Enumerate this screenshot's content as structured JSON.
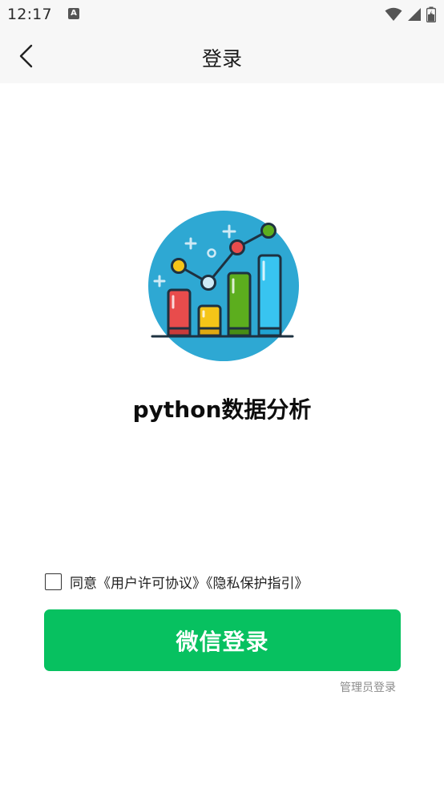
{
  "status_bar": {
    "time": "12:17",
    "notification_icon": "a-icon",
    "icons": [
      "wifi-icon",
      "signal-icon",
      "battery-icon"
    ]
  },
  "nav": {
    "back_icon": "chevron-left-icon",
    "title": "登录"
  },
  "app": {
    "logo_icon": "bar-chart-logo-icon",
    "name": "python数据分析"
  },
  "agreement": {
    "prefix": "同意",
    "user_license": "《用户许可协议》",
    "privacy_guide": "《隐私保护指引》",
    "checked": false
  },
  "actions": {
    "wechat_login_label": "微信登录",
    "admin_login_label": "管理员登录"
  },
  "colors": {
    "primary_green": "#07c160",
    "header_bg": "#f7f7f7",
    "logo_circle": "#2ea8d3"
  }
}
